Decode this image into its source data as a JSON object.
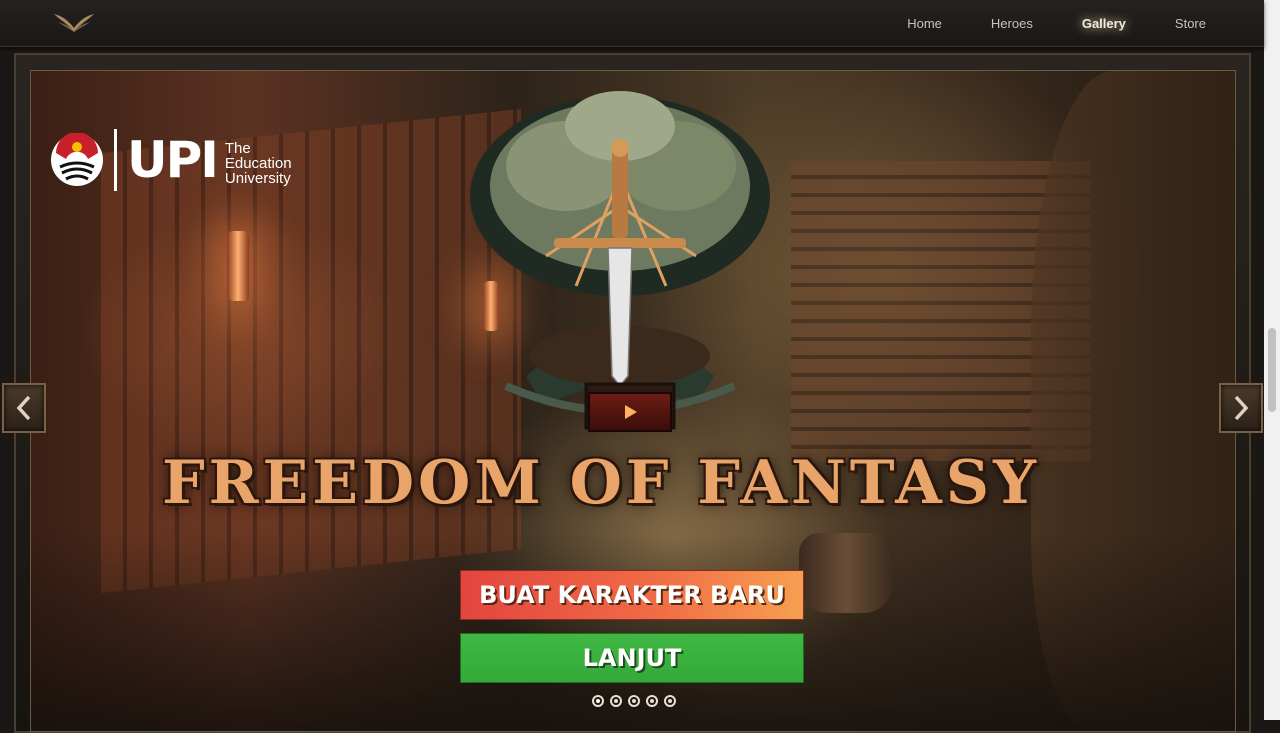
{
  "nav": {
    "items": [
      {
        "label": "Home"
      },
      {
        "label": "Heroes"
      },
      {
        "label": "Gallery"
      },
      {
        "label": "Store"
      }
    ],
    "active": "Gallery"
  },
  "hero": {
    "partner_logo": {
      "mark": "UPI",
      "text_line1": "The",
      "text_line2": "Education",
      "text_line3": "University"
    },
    "title": "FREEDOM OF FANTASY",
    "buttons": {
      "new_character": "BUAT KARAKTER BARU",
      "continue": "LANJUT"
    },
    "slides": 5,
    "active_slide": 1
  },
  "colors": {
    "title": "#e9a46a",
    "button_new": "#f06a45",
    "button_continue": "#3fb842"
  },
  "icons": {
    "logo": "wings-logo-icon",
    "play": "play-icon",
    "prev": "chevron-left-icon",
    "next": "chevron-right-icon"
  }
}
